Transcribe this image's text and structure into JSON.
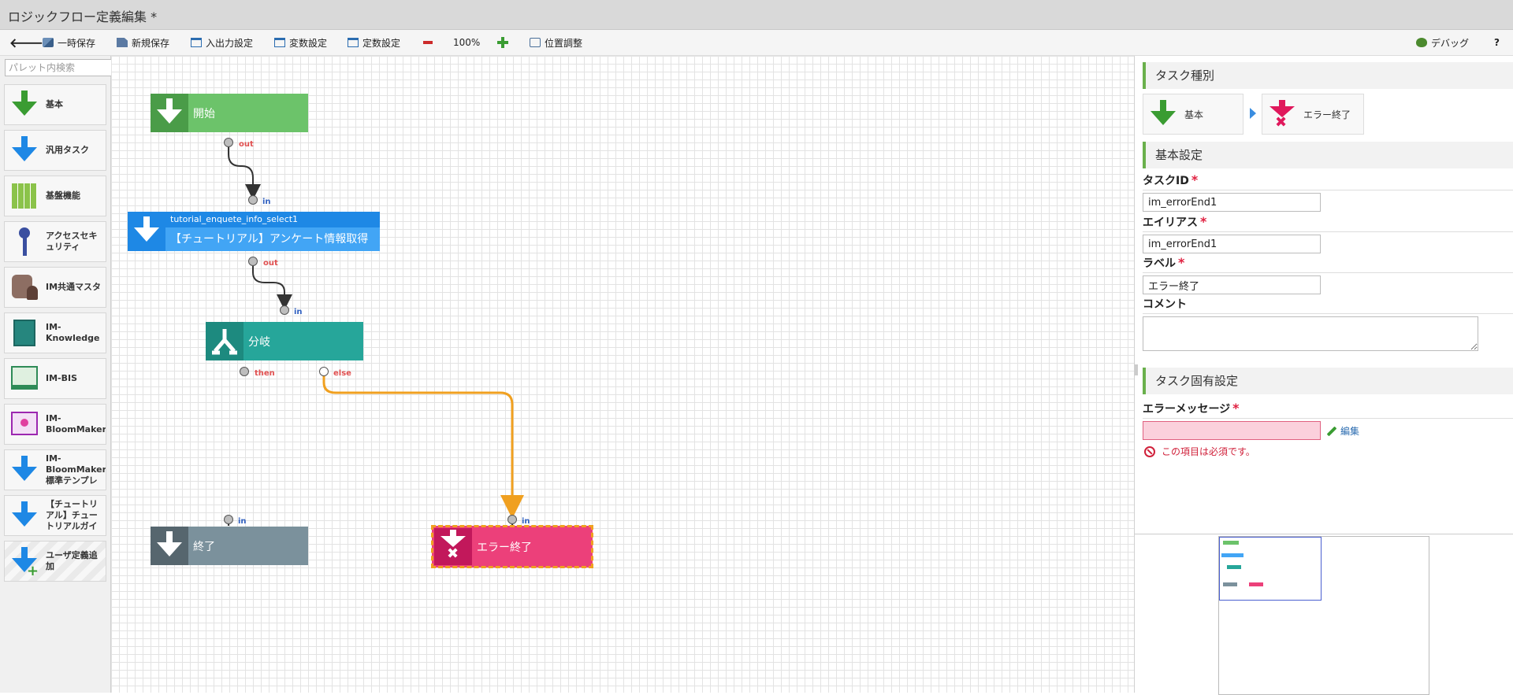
{
  "window": {
    "title": "ロジックフロー定義編集 *"
  },
  "toolbar": {
    "temp_save": "一時保存",
    "new_save": "新規保存",
    "io_settings": "入出力設定",
    "var_settings": "変数設定",
    "const_settings": "定数設定",
    "zoom": "100%",
    "position_adjust": "位置調整",
    "debug": "デバッグ",
    "help": "?"
  },
  "palette": {
    "search_placeholder": "パレット内検索",
    "items": [
      {
        "label": "基本",
        "icon": "green-down-arrow-icon"
      },
      {
        "label": "汎用タスク",
        "icon": "blue-down-arrow-icon"
      },
      {
        "label": "基盤機能",
        "icon": "green-grid-icon"
      },
      {
        "label": "アクセスセキュリティ",
        "icon": "key-icon"
      },
      {
        "label": "IM共通マスタ",
        "icon": "database-user-icon"
      },
      {
        "label": "IM-Knowledge",
        "icon": "book-icon"
      },
      {
        "label": "IM-BIS",
        "icon": "window-flow-icon"
      },
      {
        "label": "IM-BloomMaker",
        "icon": "flower-window-icon"
      },
      {
        "label": "IM-BloomMaker 標準テンプレ",
        "icon": "blue-down-arrow-icon"
      },
      {
        "label": "【チュートリアル】チュートリアルガイ",
        "icon": "blue-down-arrow-icon"
      },
      {
        "label": "ユーザ定義追加",
        "icon": "add-arrow-icon"
      }
    ]
  },
  "canvas": {
    "nodes": {
      "start": {
        "label": "開始"
      },
      "task": {
        "id": "tutorial_enquete_info_select1",
        "label": "【チュートリアル】アンケート情報取得"
      },
      "branch": {
        "label": "分岐"
      },
      "end": {
        "label": "終了"
      },
      "error_end": {
        "label": "エラー終了"
      }
    },
    "ports": {
      "out": "out",
      "in": "in",
      "then": "then",
      "else": "else"
    }
  },
  "properties": {
    "task_type": {
      "header": "タスク種別",
      "category": "基本",
      "type": "エラー終了"
    },
    "basic": {
      "header": "基本設定",
      "task_id_label": "タスクID",
      "task_id_value": "im_errorEnd1",
      "alias_label": "エイリアス",
      "alias_value": "im_errorEnd1",
      "label_label": "ラベル",
      "label_value": "エラー終了",
      "comment_label": "コメント",
      "required_mark": "*"
    },
    "specific": {
      "header": "タスク固有設定",
      "error_message_label": "エラーメッセージ",
      "edit_link": "編集",
      "validation_error": "この項目は必須です。"
    }
  },
  "colors": {
    "start": "#5cb85c",
    "task": "#1e88e5",
    "branch": "#26a69a",
    "end": "#78909c",
    "error_end": "#e53977",
    "connector_selected": "#f0a020"
  }
}
